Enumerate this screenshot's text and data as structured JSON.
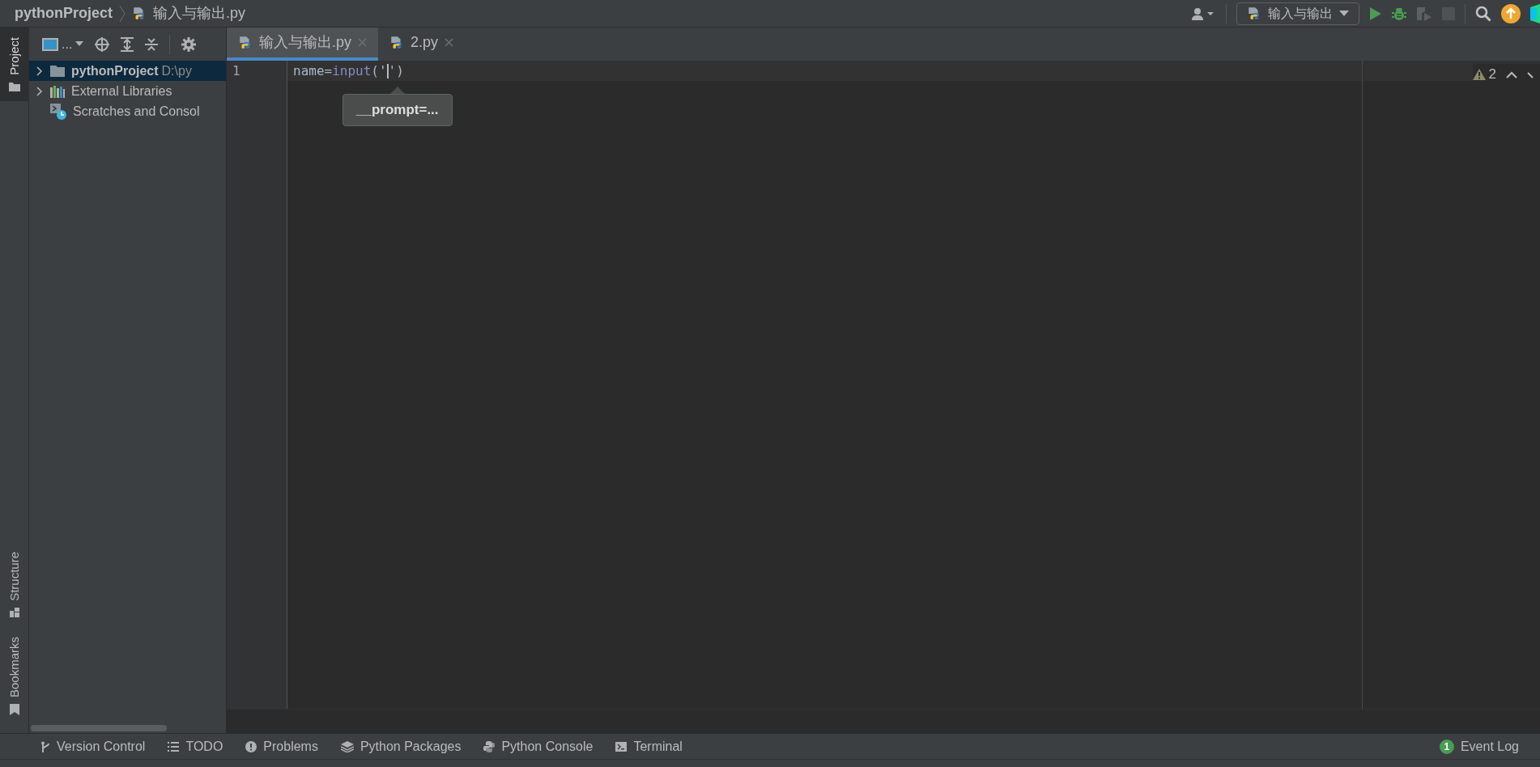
{
  "breadcrumb": [
    {
      "text": "pythonProject",
      "kind": "project"
    },
    {
      "text": "输入与输出.py",
      "kind": "file"
    }
  ],
  "run_config": {
    "label": "输入与输出"
  },
  "left_strip": [
    {
      "label": "Project",
      "selected": true,
      "kind": "top"
    },
    {
      "label": "Structure",
      "selected": false,
      "kind": "structure"
    },
    {
      "label": "Bookmarks",
      "selected": false,
      "kind": "bookmarks"
    }
  ],
  "project_toolbar": {
    "view_label": "..."
  },
  "tree": [
    {
      "label": "pythonProject",
      "path": "D:\\py",
      "selected": true,
      "expanded": false,
      "kind": "folder"
    },
    {
      "label": "External Libraries",
      "selected": false,
      "expanded": false,
      "kind": "libraries"
    },
    {
      "label": "Scratches and Consol",
      "selected": false,
      "kind": "scratches"
    }
  ],
  "tabs": [
    {
      "label": "输入与输出.py",
      "selected": true
    },
    {
      "label": "2.py",
      "selected": false
    }
  ],
  "editor": {
    "lines": [
      {
        "number": "1",
        "tokens": [
          {
            "text": "name=",
            "kind": "plain"
          },
          {
            "text": "input",
            "kind": "builtin"
          },
          {
            "text": "('",
            "kind": "plain"
          },
          {
            "kind": "caret"
          },
          {
            "text": "')",
            "kind": "plain"
          }
        ]
      }
    ],
    "hint": "__prompt=...",
    "warnings": "2"
  },
  "bottom_tools": [
    {
      "label": "Version Control",
      "kind": "vcs"
    },
    {
      "label": "TODO",
      "kind": "todo"
    },
    {
      "label": "Problems",
      "kind": "problems"
    },
    {
      "label": "Python Packages",
      "kind": "packages"
    },
    {
      "label": "Python Console",
      "kind": "console"
    },
    {
      "label": "Terminal",
      "kind": "terminal"
    }
  ],
  "event_log": {
    "label": "Event Log",
    "count": "1"
  }
}
